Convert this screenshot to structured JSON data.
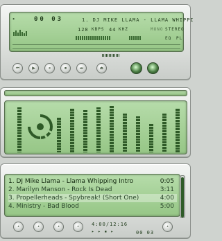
{
  "player": {
    "time": "00 03",
    "title_scroll": "1. DJ MIKE LLAMA - LLAMA WHIPPI",
    "kbps": "128",
    "kbps_label": "KBPS",
    "khz": "44",
    "khz_label": "KHZ",
    "mono_label": "MONO",
    "stereo_label": "STEREO",
    "eq_label": "EQ",
    "pl_label": "PL",
    "buttons": [
      "⏮",
      "▶",
      "⏸",
      "⏹",
      "⏭",
      "⏏"
    ]
  },
  "equalizer": {
    "levels": [
      0.95,
      0.9,
      0.78,
      0.74,
      0.92,
      0.9,
      0.95,
      0.98,
      0.82,
      0.76,
      0.6,
      0.82,
      0.92
    ]
  },
  "playlist": {
    "tracks": [
      {
        "name": "1. DJ Mike Llama - Llama Whipping Intro",
        "time": "0:05"
      },
      {
        "name": "2. Marilyn Manson - Rock Is Dead",
        "time": "3:11"
      },
      {
        "name": "3. Propellerheads - Spybreak! (Short One)",
        "time": "4:00"
      },
      {
        "name": "4. Ministry - Bad Blood",
        "time": "5:00"
      }
    ],
    "total_time": "4:00/12:16",
    "mini_time": "00 03"
  },
  "colors": {
    "lcd_bg": "#a8d29a",
    "lcd_text": "#1f3a1a"
  }
}
